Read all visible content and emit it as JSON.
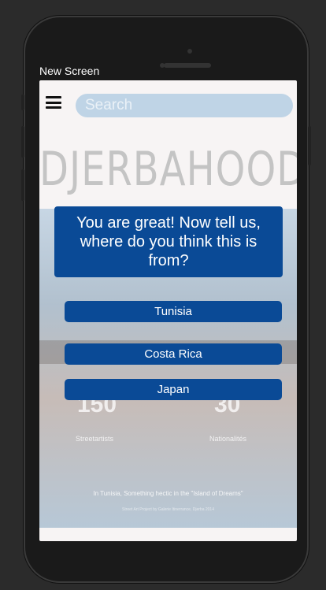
{
  "frame": {
    "title": "New Screen"
  },
  "header": {
    "search_placeholder": "Search",
    "brand": "DJERBAHOOD"
  },
  "quiz": {
    "question": "You are great! Now tell us, where do you think this is from?",
    "options": [
      "Tunisia",
      "Costa Rica",
      "Japan"
    ]
  },
  "background": {
    "stats": [
      {
        "value": "150",
        "label": "Streetartists"
      },
      {
        "value": "30",
        "label": "Nationalités"
      }
    ],
    "caption": "In Tunisia, Something hectic in the \"Island of Dreams\"",
    "subcaption": "Street Art Project by Galerie Itinerrance, Djerba 2014"
  },
  "colors": {
    "primary": "#0a4a96",
    "search_bg": "#bfd4e6"
  }
}
